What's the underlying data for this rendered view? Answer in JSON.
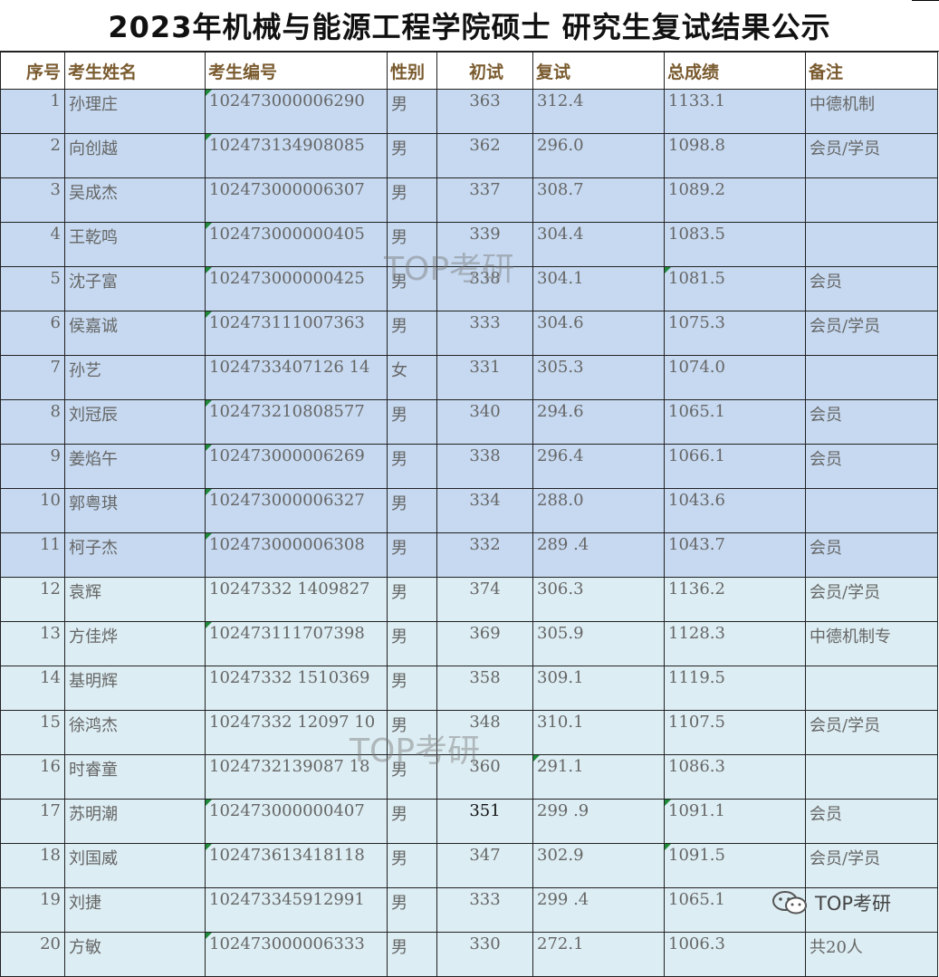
{
  "title": "2023年机械与能源工程学院硕士 研究生复试结果公示",
  "headers": [
    "序号",
    "考生姓名",
    "考生编号",
    "性别",
    "初试",
    "复试",
    "总成绩",
    "备注"
  ],
  "rows": [
    {
      "no": "1",
      "name": "孙理庄",
      "id": "102473000006290",
      "sex": "男",
      "s1": "363",
      "s2": "312.4",
      "total": "1133.1",
      "note": "中德机制"
    },
    {
      "no": "2",
      "name": "向创越",
      "id": "102473134908085",
      "sex": "男",
      "s1": "362",
      "s2": "296.0",
      "total": "1098.8",
      "note": "会员/学员"
    },
    {
      "no": "3",
      "name": "吴成杰",
      "id": "102473000006307",
      "sex": "男",
      "s1": "337",
      "s2": "308.7",
      "total": "1089.2",
      "note": ""
    },
    {
      "no": "4",
      "name": "王乾鸣",
      "id": "102473000000405",
      "sex": "男",
      "s1": "339",
      "s2": "304.4",
      "total": "1083.5",
      "note": ""
    },
    {
      "no": "5",
      "name": "沈子富",
      "id": "102473000000425",
      "sex": "男",
      "s1": "338",
      "s2": "304.1",
      "total": "1081.5",
      "note": "会员"
    },
    {
      "no": "6",
      "name": "侯嘉诚",
      "id": "102473111007363",
      "sex": "男",
      "s1": "333",
      "s2": "304.6",
      "total": "1075.3",
      "note": "会员/学员"
    },
    {
      "no": "7",
      "name": "孙艺",
      "id": "1024733407126 14",
      "sex": "女",
      "s1": "331",
      "s2": "305.3",
      "total": "1074.0",
      "note": ""
    },
    {
      "no": "8",
      "name": "刘冠辰",
      "id": "102473210808577",
      "sex": "男",
      "s1": "340",
      "s2": "294.6",
      "total": "1065.1",
      "note": "会员"
    },
    {
      "no": "9",
      "name": "姜焰午",
      "id": "102473000006269",
      "sex": "男",
      "s1": "338",
      "s2": "296.4",
      "total": "1066.1",
      "note": "会员"
    },
    {
      "no": "10",
      "name": "郭粤琪",
      "id": "102473000006327",
      "sex": "男",
      "s1": "334",
      "s2": "288.0",
      "total": "1043.6",
      "note": ""
    },
    {
      "no": "11",
      "name": "柯子杰",
      "id": "102473000006308",
      "sex": "男",
      "s1": "332",
      "s2": "289 .4",
      "total": "1043.7",
      "note": "会员"
    },
    {
      "no": "12",
      "name": "袁辉",
      "id": "10247332 1409827",
      "sex": "男",
      "s1": "374",
      "s2": "306.3",
      "total": "1136.2",
      "note": "会员/学员"
    },
    {
      "no": "13",
      "name": "方佳烨",
      "id": "102473111707398",
      "sex": "男",
      "s1": "369",
      "s2": "305.9",
      "total": "1128.3",
      "note": "中德机制专"
    },
    {
      "no": "14",
      "name": "基明辉",
      "id": "10247332 1510369",
      "sex": "男",
      "s1": "358",
      "s2": "309.1",
      "total": "1119.5",
      "note": ""
    },
    {
      "no": "15",
      "name": "徐鸿杰",
      "id": "10247332 12097 10",
      "sex": "男",
      "s1": "348",
      "s2": "310.1",
      "total": "1107.5",
      "note": "会员/学员"
    },
    {
      "no": "16",
      "name": "时睿童",
      "id": "1024732139087 18",
      "sex": "男",
      "s1": "360",
      "s2": "291.1",
      "total": "1086.3",
      "note": ""
    },
    {
      "no": "17",
      "name": "苏明潮",
      "id": "102473000000407",
      "sex": "男",
      "s1": "351",
      "s2": "299 .9",
      "total": "1091.1",
      "note": "会员"
    },
    {
      "no": "18",
      "name": "刘国威",
      "id": "102473613418118",
      "sex": "男",
      "s1": "347",
      "s2": "302.9",
      "total": "1091.5",
      "note": "会员/学员"
    },
    {
      "no": "19",
      "name": "刘捷",
      "id": "102473345912991",
      "sex": "男",
      "s1": "333",
      "s2": "299 .4",
      "total": "1065.1",
      "note": ""
    },
    {
      "no": "20",
      "name": "方敏",
      "id": "102473000006333",
      "sex": "男",
      "s1": "330",
      "s2": "272.1",
      "total": "1006.3",
      "note": "共20人"
    }
  ],
  "watermark": "TOP考研",
  "wechat_label": "TOP考研",
  "colors": {
    "group1": "#c6d9f0",
    "group2": "#dcedf3",
    "header_text": "#7a5b2f"
  }
}
